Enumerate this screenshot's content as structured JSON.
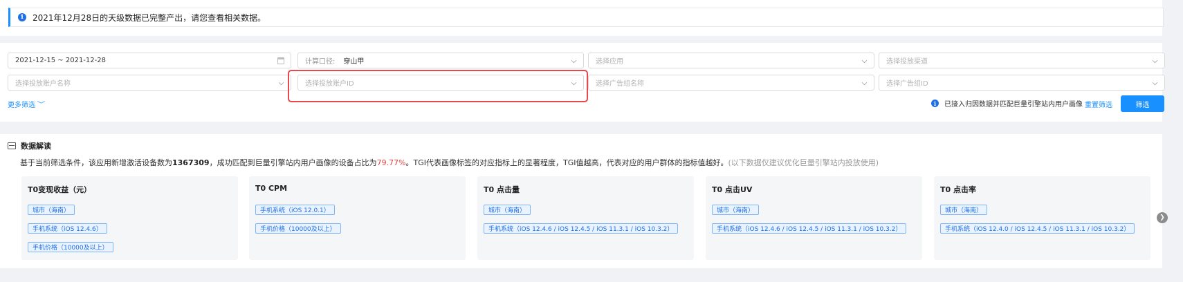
{
  "alert": {
    "text": "2021年12月28日的天级数据已完整产出，请您查看相关数据。",
    "icon": "info-icon"
  },
  "filters": {
    "date_range": "2021-12-15 ~ 2021-12-28",
    "calc_prefix": "计算口径:",
    "calc_value": "穿山甲",
    "app_placeholder": "选择应用",
    "channel_placeholder": "选择投放渠道",
    "account_name_placeholder": "选择投放账户名称",
    "account_id_placeholder": "选择投放账户ID",
    "adgroup_name_placeholder": "选择广告组名称",
    "adgroup_id_placeholder": "选择广告组ID",
    "more_label": "更多筛选",
    "hint": "已接入归因数据并匹配巨量引擎站内用户画像",
    "reset_label": "重置筛选",
    "submit_label": "筛选"
  },
  "insight": {
    "title": "数据解读",
    "desc_part1": "基于当前筛选条件，该应用新增激活设备数为",
    "device_count": "1367309",
    "desc_part2": "，成功匹配到巨量引擎站内用户画像的设备占比为",
    "match_rate": "79.77%",
    "desc_part3": "。TGI代表画像标签的对应指标上的显著程度，TGI值越高，代表对应的用户群体的指标值越好。",
    "desc_note": "(以下数据仅建议优化巨量引擎站内投放使用)"
  },
  "cards": [
    {
      "title": "T0变现收益（元）",
      "tags": [
        "城市（海南）",
        "手机系统（iOS 12.4.6）",
        "手机价格（10000及以上）"
      ]
    },
    {
      "title": "T0 CPM",
      "tags": [
        "手机系统（iOS 12.0.1）",
        "手机价格（10000及以上）"
      ]
    },
    {
      "title": "T0 点击量",
      "tags": [
        "城市（海南）",
        "手机系统（iOS 12.4.6 / iOS 12.4.5 / iOS 11.3.1 / iOS 10.3.2）"
      ]
    },
    {
      "title": "T0 点击UV",
      "tags": [
        "城市（海南）",
        "手机系统（iOS 12.4.6 / iOS 12.4.5 / iOS 11.3.1 / iOS 10.3.2）"
      ]
    },
    {
      "title": "T0 点击率",
      "tags": [
        "城市（海南）",
        "手机系统（iOS 12.4.0 / iOS 12.4.5 / iOS 11.3.1 / iOS 10.3.2）"
      ]
    }
  ],
  "colors": {
    "accent": "#1890ff",
    "highlight": "#e84040",
    "annotation_box": "#e5484d"
  }
}
